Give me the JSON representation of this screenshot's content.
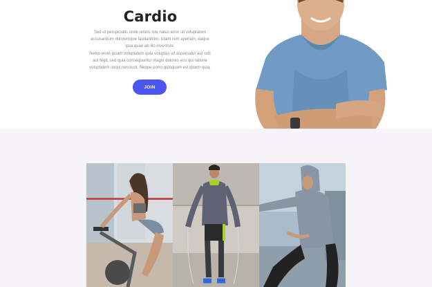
{
  "hero": {
    "title": "Cardio",
    "paragraph1": "Sed ut perspiciatis unde omnis iste natus error sit voluptatem accusantium doloremque laudantium, totam rem aperiam, eaque ipsa quae ab illo inventore.",
    "paragraph2": "Nemo enim ipsam voluptatem quia voluptas sit aspernatur aut odit aut fugit, sed quia consequuntur magni dolores eos qui ratione voluptatem sequi nesciunt. Neque porro quisquam est ipsum quia.",
    "join_label": "JOIN",
    "accent_color": "#4a55f0"
  },
  "images": {
    "hero_image": "man-in-blue-tshirt-photo",
    "gallery": [
      {
        "name": "woman-spin-bike-photo"
      },
      {
        "name": "man-jump-rope-photo"
      },
      {
        "name": "man-hoodie-stretching-photo"
      }
    ]
  }
}
